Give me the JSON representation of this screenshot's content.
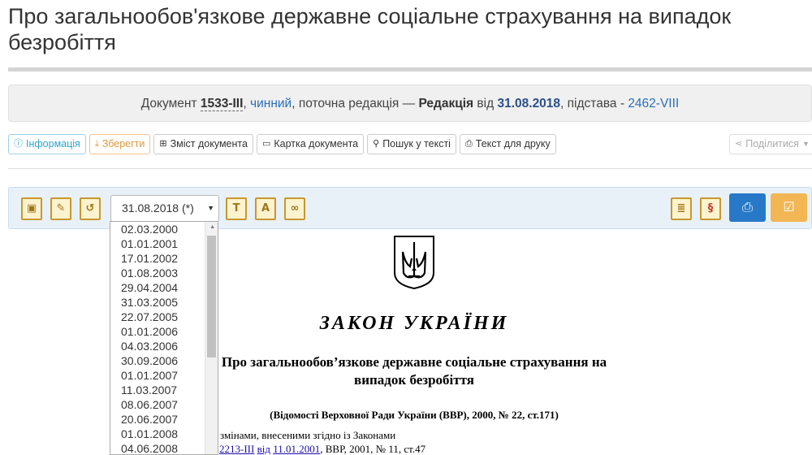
{
  "page": {
    "title": "Про загальнообов'язкове державне соціальне страхування на випадок безробіття"
  },
  "doc_info": {
    "prefix": "Документ",
    "number": "1533-III",
    "status": "чинний",
    "edition_text": ", поточна редакція —",
    "edition_label": "Редакція",
    "from_word": "від",
    "edition_date": "31.08.2018",
    "basis_text": ", підстава -",
    "basis_link": "2462-VIII"
  },
  "buttons": {
    "info": "Інформація",
    "save": "Зберегти",
    "contents": "Зміст документа",
    "card": "Картка документа",
    "search": "Пошук у тексті",
    "print_text": "Текст для друку",
    "share": "Поділитися"
  },
  "toolbar": {
    "selected_date": "31.08.2018 (*)"
  },
  "dropdown": {
    "options": [
      "02.03.2000",
      "01.01.2001",
      "17.01.2002",
      "01.08.2003",
      "29.04.2004",
      "31.03.2005",
      "22.07.2005",
      "01.01.2006",
      "04.03.2006",
      "30.09.2006",
      "01.01.2007",
      "11.03.2007",
      "08.06.2007",
      "20.06.2007",
      "01.01.2008",
      "04.06.2008"
    ]
  },
  "law": {
    "heading": "ЗАКОН УКРАЇНИ",
    "title_line1": "Про загальнообов’язкове державне соціальне страхування на",
    "title_line2": "випадок безробіття",
    "source": "(Відомості Верховної Ради України (ВВР), 2000, № 22, ст.171)",
    "amend_line1": "змінами, внесеними згідно із Законами",
    "amend_link1": "2213-III",
    "amend_mid": "від",
    "amend_link2": "11.01.2001",
    "amend_tail": ", ВВР, 2001, № 11, ст.47"
  },
  "colors": {
    "link": "#2a6ebb",
    "print_button": "#2878c8",
    "check_button": "#f2b654",
    "icon_border": "#c8972f"
  }
}
